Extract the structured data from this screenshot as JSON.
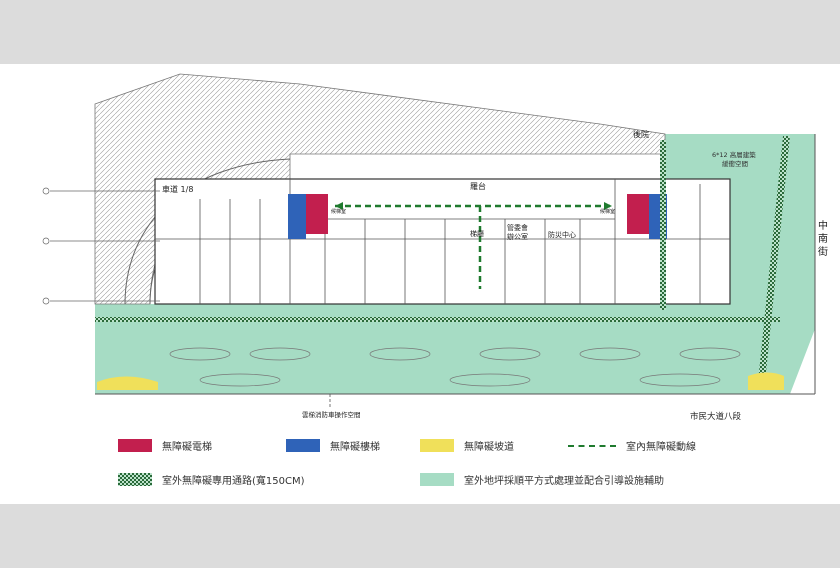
{
  "plan_labels": {
    "ramp_slope": "車道 1/8",
    "back_yard": "後院",
    "platform": "羅台",
    "lobby": "梯廳",
    "management_office": "管委會\n辦公室",
    "disaster_center": "防災中心",
    "corner_space": "6*12 高層建築\n緩衝空間",
    "street_east": "中南街",
    "boulevard": "市民大道八段",
    "fire_space": "雲梯消防車操作空間",
    "lift_lobby_w": "候梯室",
    "lift_lobby_e": "候梯室"
  },
  "legend": {
    "elevator": {
      "label": "無障礙電梯",
      "color": "#c21f4e"
    },
    "stair": {
      "label": "無障礙樓梯",
      "color": "#2f63b8"
    },
    "ramp": {
      "label": "無障礙坡道",
      "color": "#f0e05a"
    },
    "indoor_route": {
      "label": "室內無障礙動線",
      "color": "#1f7a2e"
    },
    "outdoor_path": {
      "label": "室外無障礙專用通路(寬150CM)",
      "color": "#2a6a3a"
    },
    "outdoor_area": {
      "label": "室外地坪採順平方式處理並配合引導設施輔助",
      "color": "#a6dcc4"
    }
  }
}
